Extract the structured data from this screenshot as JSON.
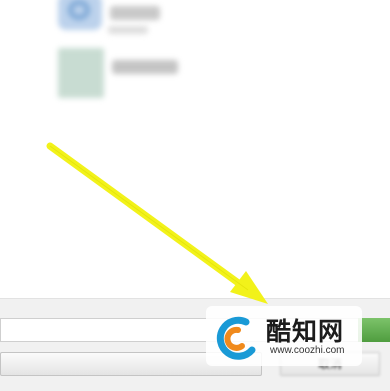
{
  "list_items": [
    {
      "icon": "folder-icon"
    },
    {
      "icon": "image-file-icon"
    }
  ],
  "annotation": {
    "arrow_color": "#f2f21a"
  },
  "dialog": {
    "filename_value": "",
    "cancel_label": "取消",
    "accent_color": "#5aa84a"
  },
  "watermark": {
    "title": "酷知网",
    "url": "www.coozhi.com"
  }
}
